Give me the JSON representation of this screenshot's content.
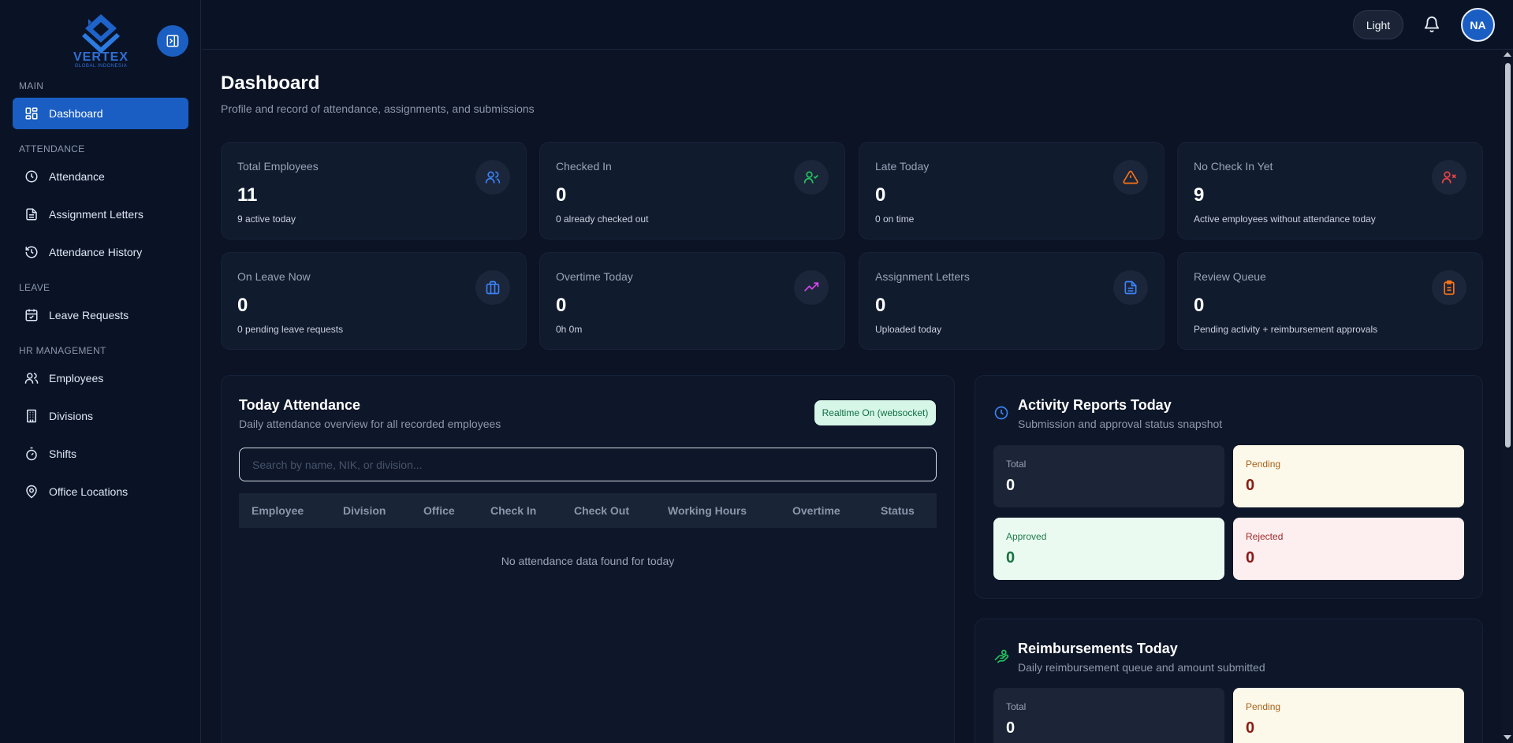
{
  "brand": {
    "name": "VERTEX",
    "tagline": "GLOBAL INDONESIA"
  },
  "sidebar": {
    "sections": [
      "MAIN",
      "ATTENDANCE",
      "LEAVE",
      "HR MANAGEMENT"
    ],
    "items": [
      {
        "label": "Dashboard",
        "icon": "dashboard-icon",
        "active": true
      },
      {
        "label": "Attendance",
        "icon": "clock-icon"
      },
      {
        "label": "Assignment Letters",
        "icon": "document-icon"
      },
      {
        "label": "Attendance History",
        "icon": "history-icon"
      },
      {
        "label": "Leave Requests",
        "icon": "calendar-check-icon"
      },
      {
        "label": "Employees",
        "icon": "users-icon"
      },
      {
        "label": "Divisions",
        "icon": "building-icon"
      },
      {
        "label": "Shifts",
        "icon": "timer-icon"
      },
      {
        "label": "Office Locations",
        "icon": "map-pin-icon"
      }
    ]
  },
  "header": {
    "theme_label": "Light",
    "avatar_initials": "NA"
  },
  "page": {
    "title": "Dashboard",
    "subtitle": "Profile and record of attendance, assignments, and submissions"
  },
  "stats": [
    {
      "label": "Total Employees",
      "value": "11",
      "note": "9 active today",
      "icon": "users-icon",
      "color": "#3b82f6"
    },
    {
      "label": "Checked In",
      "value": "0",
      "note": "0 already checked out",
      "icon": "user-check-icon",
      "color": "#22c55e"
    },
    {
      "label": "Late Today",
      "value": "0",
      "note": "0 on time",
      "icon": "alert-triangle-icon",
      "color": "#f97316"
    },
    {
      "label": "No Check In Yet",
      "value": "9",
      "note": "Active employees without attendance today",
      "icon": "user-x-icon",
      "color": "#ef4444"
    },
    {
      "label": "On Leave Now",
      "value": "0",
      "note": "0 pending leave requests",
      "icon": "briefcase-icon",
      "color": "#3b82f6"
    },
    {
      "label": "Overtime Today",
      "value": "0",
      "note": "0h 0m",
      "icon": "trending-up-icon",
      "color": "#d946ef"
    },
    {
      "label": "Assignment Letters",
      "value": "0",
      "note": "Uploaded today",
      "icon": "file-text-icon",
      "color": "#3b82f6"
    },
    {
      "label": "Review Queue",
      "value": "0",
      "note": "Pending activity + reimbursement approvals",
      "icon": "clipboard-icon",
      "color": "#f97316"
    }
  ],
  "attendance": {
    "title": "Today Attendance",
    "subtitle": "Daily attendance overview for all recorded employees",
    "realtime_badge": "Realtime On (websocket)",
    "search_placeholder": "Search by name, NIK, or division...",
    "columns": [
      "Employee",
      "Division",
      "Office",
      "Check In",
      "Check Out",
      "Working Hours",
      "Overtime",
      "Status"
    ],
    "empty_text": "No attendance data found for today"
  },
  "activity": {
    "title": "Activity Reports Today",
    "subtitle": "Submission and approval status snapshot",
    "total": {
      "label": "Total",
      "value": "0"
    },
    "pending": {
      "label": "Pending",
      "value": "0"
    },
    "approved": {
      "label": "Approved",
      "value": "0"
    },
    "rejected": {
      "label": "Rejected",
      "value": "0"
    }
  },
  "reimbursement": {
    "title": "Reimbursements Today",
    "subtitle": "Daily reimbursement queue and amount submitted",
    "total": {
      "label": "Total",
      "value": "0"
    },
    "pending": {
      "label": "Pending",
      "value": "0"
    }
  }
}
